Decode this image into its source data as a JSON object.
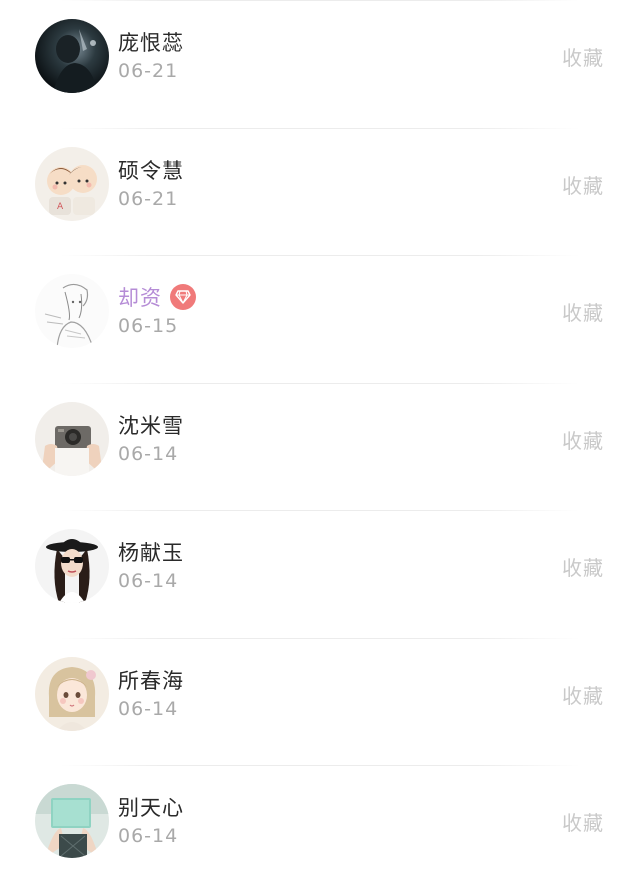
{
  "items": [
    {
      "name": "庞恨蕊",
      "date": "06-21",
      "action": "收藏",
      "avatar": "dark-night-avatar",
      "vip": false
    },
    {
      "name": "硕令慧",
      "date": "06-21",
      "action": "收藏",
      "avatar": "cartoon-couple-avatar",
      "vip": false
    },
    {
      "name": "却资",
      "date": "06-15",
      "action": "收藏",
      "avatar": "pencil-sketch-avatar",
      "vip": true,
      "badge_icon": "diamond-icon",
      "name_color": "#b58cd6"
    },
    {
      "name": "沈米雪",
      "date": "06-14",
      "action": "收藏",
      "avatar": "camera-hands-avatar",
      "vip": false
    },
    {
      "name": "杨献玉",
      "date": "06-14",
      "action": "收藏",
      "avatar": "hat-sunglasses-girl-avatar",
      "vip": false
    },
    {
      "name": "所春海",
      "date": "06-14",
      "action": "收藏",
      "avatar": "illustrated-girl-avatar",
      "vip": false
    },
    {
      "name": "别天心",
      "date": "06-14",
      "action": "收藏",
      "avatar": "book-reading-avatar",
      "vip": false
    }
  ],
  "colors": {
    "name": "#2a2a2a",
    "vip_name": "#b58cd6",
    "date": "#a9a9a9",
    "action": "#c9c9c9",
    "badge": "#f07a7a"
  }
}
